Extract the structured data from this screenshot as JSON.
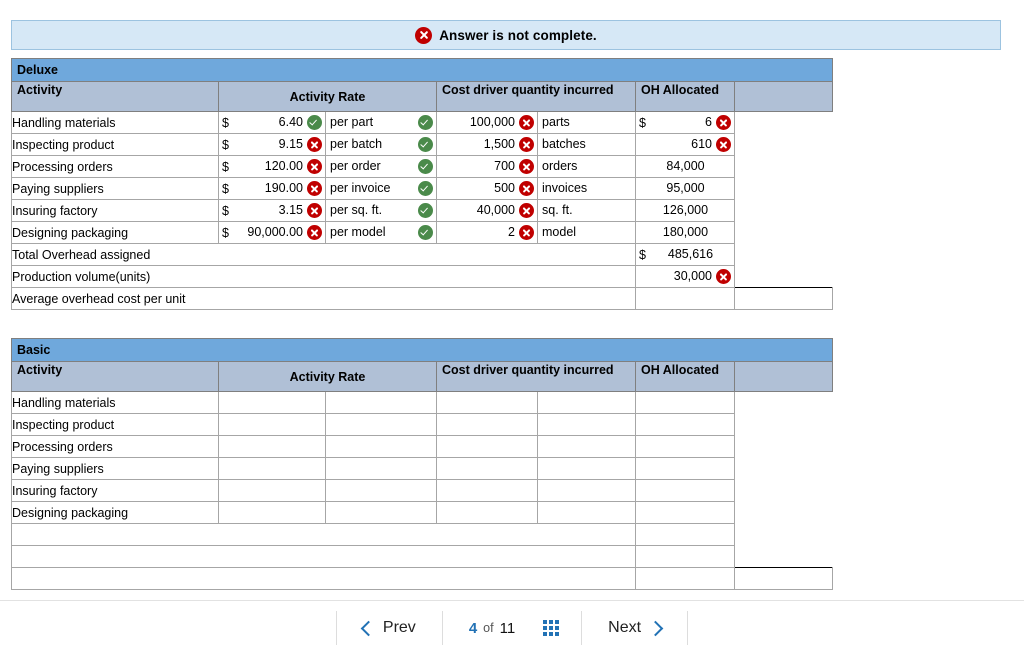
{
  "alert": {
    "icon": "error-circle-icon",
    "text": "Answer is not complete."
  },
  "colors": {
    "banner_bg": "#d6e8f6",
    "banner_border": "#9cc3e0",
    "title_bg": "#6fa8dc",
    "header_bg": "#b0c0d6",
    "correct_bg": "#f2f9f1",
    "incorrect_bg": "#fdf1f1",
    "highlight_bg": "#fcf7b6",
    "accent": "#2272b5",
    "error_red": "#c00000",
    "ok_green": "#4a8a4a"
  },
  "columns": {
    "activity": "Activity",
    "activity_rate": "Activity Rate",
    "cost_driver": "Cost driver quantity incurred",
    "oh_allocated": "OH Allocated"
  },
  "deluxe": {
    "title": "Deluxe",
    "rows": [
      {
        "activity": "Handling materials",
        "rate_symbol": "$",
        "rate": "6.40",
        "rate_status": "correct",
        "unit": "per part",
        "unit_status": "correct",
        "qty": "100,000",
        "qty_status": "incorrect",
        "driver": "parts",
        "oh_symbol": "$",
        "oh": "6",
        "oh_status": "incorrect"
      },
      {
        "activity": "Inspecting product",
        "rate_symbol": "$",
        "rate": "9.15",
        "rate_status": "incorrect",
        "unit": "per batch",
        "unit_status": "correct",
        "qty": "1,500",
        "qty_status": "incorrect",
        "driver": "batches",
        "oh_symbol": "",
        "oh": "610",
        "oh_status": "incorrect"
      },
      {
        "activity": "Processing orders",
        "rate_symbol": "$",
        "rate": "120.00",
        "rate_status": "incorrect",
        "unit": "per order",
        "unit_status": "correct",
        "qty": "700",
        "qty_status": "incorrect",
        "driver": "orders",
        "oh_symbol": "",
        "oh": "84,000",
        "oh_status": "none"
      },
      {
        "activity": "Paying suppliers",
        "rate_symbol": "$",
        "rate": "190.00",
        "rate_status": "incorrect",
        "unit": "per invoice",
        "unit_status": "correct",
        "qty": "500",
        "qty_status": "incorrect",
        "driver": "invoices",
        "oh_symbol": "",
        "oh": "95,000",
        "oh_status": "none"
      },
      {
        "activity": "Insuring factory",
        "rate_symbol": "$",
        "rate": "3.15",
        "rate_status": "incorrect",
        "unit": "per sq. ft.",
        "unit_status": "correct",
        "qty": "40,000",
        "qty_status": "incorrect",
        "driver": "sq. ft.",
        "oh_symbol": "",
        "oh": "126,000",
        "oh_status": "none"
      },
      {
        "activity": "Designing packaging",
        "rate_symbol": "$",
        "rate": "90,000.00",
        "rate_status": "incorrect",
        "unit": "per model",
        "unit_status": "correct",
        "qty": "2",
        "qty_status": "incorrect",
        "driver": "model",
        "oh_symbol": "",
        "oh": "180,000",
        "oh_status": "none"
      }
    ],
    "total_label": "Total Overhead assigned",
    "total_symbol": "$",
    "total_value": "485,616",
    "volume_label": "Production volume(units)",
    "volume_value": "30,000",
    "volume_status": "incorrect",
    "average_label": "Average overhead cost per unit",
    "average_value": ""
  },
  "basic": {
    "title": "Basic",
    "rows": [
      {
        "activity": "Handling materials",
        "rate_symbol": "",
        "rate": "",
        "unit": "",
        "qty": "",
        "driver": "",
        "oh": ""
      },
      {
        "activity": "Inspecting product",
        "rate_symbol": "",
        "rate": "",
        "unit": "",
        "qty": "",
        "driver": "",
        "oh": ""
      },
      {
        "activity": "Processing orders",
        "rate_symbol": "",
        "rate": "",
        "unit": "",
        "qty": "",
        "driver": "",
        "oh": ""
      },
      {
        "activity": "Paying suppliers",
        "rate_symbol": "",
        "rate": "",
        "unit": "",
        "qty": "",
        "driver": "",
        "oh": ""
      },
      {
        "activity": "Insuring factory",
        "rate_symbol": "",
        "rate": "",
        "unit": "",
        "qty": "",
        "driver": "",
        "oh": ""
      },
      {
        "activity": "Designing packaging",
        "rate_symbol": "",
        "rate": "",
        "unit": "",
        "qty": "",
        "driver": "",
        "oh": ""
      }
    ],
    "total_label": "",
    "total_value": "",
    "volume_label": "",
    "volume_value": "",
    "average_label": "",
    "average_value": ""
  },
  "pagination": {
    "prev_label": "Prev",
    "next_label": "Next",
    "current_page": "4",
    "of_label": "of",
    "total_pages": "11",
    "grid_icon": "grid-view-icon",
    "prev_icon": "chevron-left-icon",
    "next_icon": "chevron-right-icon"
  }
}
